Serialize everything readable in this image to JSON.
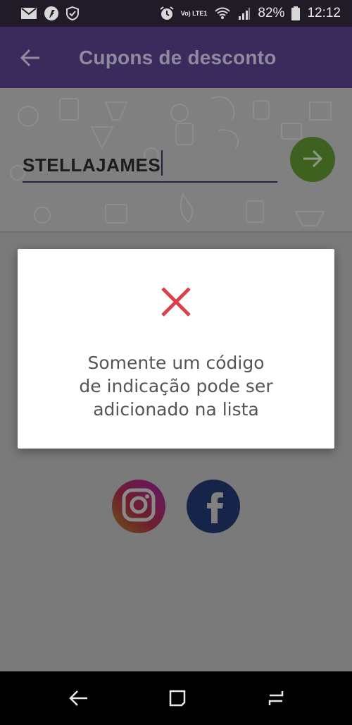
{
  "status_bar": {
    "network_label": "Vo) LTE1",
    "battery_percent": "82%",
    "time": "12:12",
    "icons": [
      "mail-icon",
      "app-notification-icon",
      "shield-icon",
      "alarm-icon",
      "wifi-icon",
      "signal-icon",
      "battery-icon"
    ]
  },
  "app_bar": {
    "title": "Cupons de desconto",
    "back_icon": "back-arrow-icon"
  },
  "coupon": {
    "input_value": "STELLAJAMES",
    "submit_icon": "arrow-right-icon"
  },
  "dialog": {
    "icon": "close-x-icon",
    "message_lines": [
      "Somente um código",
      "de indicação pode ser",
      "adicionado na lista"
    ]
  },
  "social": {
    "items": [
      "instagram-icon",
      "facebook-icon"
    ]
  },
  "nav_bar": {
    "items": [
      "nav-back-icon",
      "nav-home-icon",
      "nav-recents-icon"
    ]
  },
  "colors": {
    "app_bar": "#3b2a5c",
    "status_bar": "#201b26",
    "submit_button": "#3f6120",
    "error_x": "#d8404b",
    "facebook": "#17244a"
  }
}
